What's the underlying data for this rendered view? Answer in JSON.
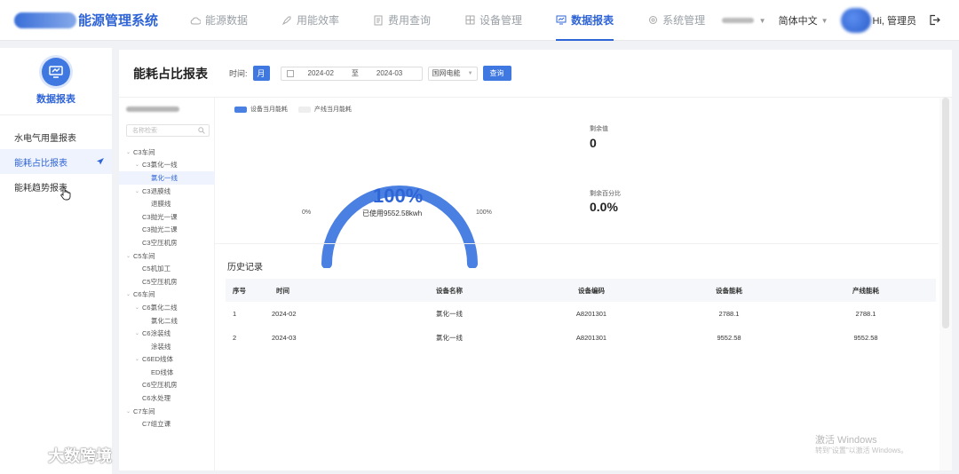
{
  "header": {
    "app_title": "能源管理系统",
    "nav": [
      {
        "label": "能源数据",
        "icon": "cloud-icon",
        "active": false
      },
      {
        "label": "用能效率",
        "icon": "rocket-icon",
        "active": false
      },
      {
        "label": "费用查询",
        "icon": "document-icon",
        "active": false
      },
      {
        "label": "设备管理",
        "icon": "grid-icon",
        "active": false
      },
      {
        "label": "数据报表",
        "icon": "chart-icon",
        "active": true
      },
      {
        "label": "系统管理",
        "icon": "gear-icon",
        "active": false
      }
    ],
    "language": "简体中文",
    "greeting": "Hi, 管理员"
  },
  "sidebar": {
    "title": "数据报表",
    "items": [
      {
        "label": "水电气用量报表"
      },
      {
        "label": "能耗占比报表"
      },
      {
        "label": "能耗趋势报表"
      }
    ]
  },
  "toolbar": {
    "page_title": "能耗占比报表",
    "time_label": "时间:",
    "period_button": "月",
    "start_date": "2024-02",
    "range_sep": "至",
    "end_date": "2024-03",
    "select_value": "国网电能",
    "query_button": "查询"
  },
  "tree": {
    "search_placeholder": "名称检索",
    "nodes": [
      {
        "label": "C3车间",
        "level": 0,
        "arrow": true
      },
      {
        "label": "C3氯化一线",
        "level": 1,
        "arrow": true
      },
      {
        "label": "氯化一线",
        "level": 2,
        "selected": true
      },
      {
        "label": "C3退膜线",
        "level": 1,
        "arrow": true
      },
      {
        "label": "退膜线",
        "level": 2
      },
      {
        "label": "C3抛光一课",
        "level": 1
      },
      {
        "label": "C3抛光二课",
        "level": 1
      },
      {
        "label": "C3空压机房",
        "level": 1
      },
      {
        "label": "C5车间",
        "level": 0,
        "arrow": true
      },
      {
        "label": "C5机加工",
        "level": 1
      },
      {
        "label": "C5空压机房",
        "level": 1
      },
      {
        "label": "C6车间",
        "level": 0,
        "arrow": true
      },
      {
        "label": "C6氯化二线",
        "level": 1,
        "arrow": true
      },
      {
        "label": "氯化二线",
        "level": 2
      },
      {
        "label": "C6涂装线",
        "level": 1,
        "arrow": true
      },
      {
        "label": "涂装线",
        "level": 2
      },
      {
        "label": "C6ED线体",
        "level": 1,
        "arrow": true
      },
      {
        "label": "ED线体",
        "level": 2
      },
      {
        "label": "C6空压机房",
        "level": 1
      },
      {
        "label": "C6水处理",
        "level": 1
      },
      {
        "label": "C7车间",
        "level": 0,
        "arrow": true
      },
      {
        "label": "C7组立课",
        "level": 1
      }
    ]
  },
  "chart": {
    "legend": [
      {
        "label": "设备当月能耗",
        "color": "#4a80e2"
      },
      {
        "label": "产线当月能耗",
        "color": "#eeeeee"
      }
    ],
    "percent_text": "100%",
    "used_text": "已使用9552.58kwh",
    "min_label": "0%",
    "max_label": "100%",
    "remain_label": "剩余值",
    "remain_value": "0",
    "remain_pct_label": "剩余百分比",
    "remain_pct_value": "0.0%"
  },
  "chart_data": {
    "type": "gauge",
    "value": 100,
    "range": [
      0,
      100
    ],
    "used_kwh": 9552.58
  },
  "history": {
    "title": "历史记录",
    "columns": [
      "序号",
      "时间",
      "设备名称",
      "设备编码",
      "设备能耗",
      "产线能耗"
    ],
    "rows": [
      [
        "1",
        "2024-02",
        "氯化一线",
        "A8201301",
        "2788.1",
        "2788.1"
      ],
      [
        "2",
        "2024-03",
        "氯化一线",
        "A8201301",
        "9552.58",
        "9552.58"
      ]
    ]
  },
  "watermarks": {
    "brand": "大数跨境",
    "windows_line1": "激活 Windows",
    "windows_line2": "转到\"设置\"以激活 Windows。"
  },
  "colors": {
    "accent": "#2f64d6",
    "gauge": "#4a80e2"
  }
}
